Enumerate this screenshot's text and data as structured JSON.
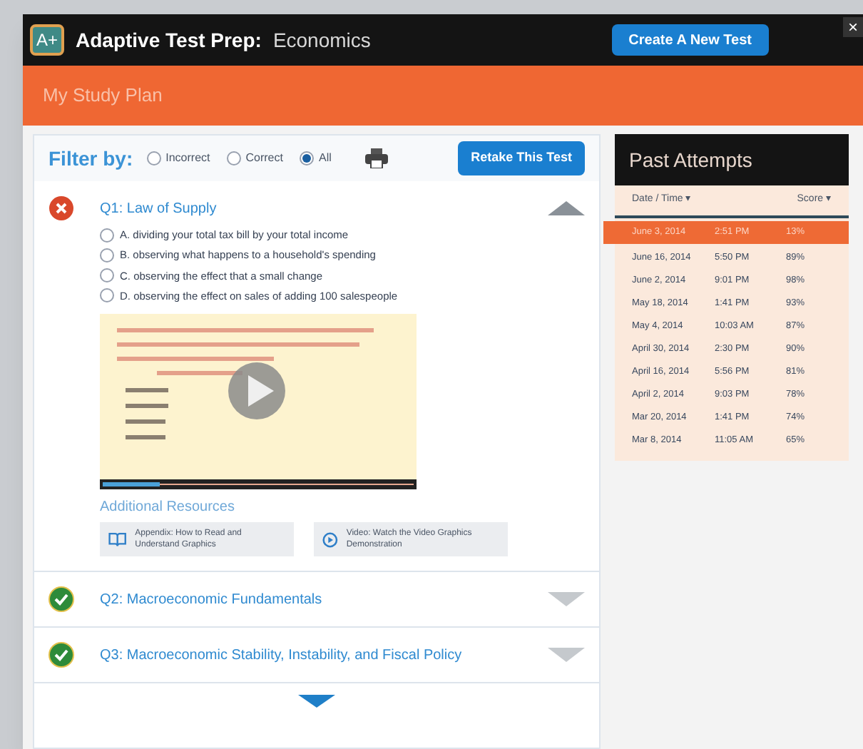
{
  "header": {
    "logo": "A+",
    "title_bold": "Adaptive Test Prep:",
    "title_subject": "Economics",
    "create_button": "Create A New Test",
    "close": "×"
  },
  "banner": {
    "title": "My Study Plan"
  },
  "filter": {
    "label": "Filter by:",
    "options": [
      {
        "label": "Incorrect",
        "selected": false
      },
      {
        "label": "Correct",
        "selected": false
      },
      {
        "label": "All",
        "selected": true
      }
    ],
    "retake_button": "Retake This Test"
  },
  "questions": [
    {
      "title": "Q1: Law of Supply",
      "correct": false,
      "expanded": true,
      "choices": [
        {
          "label": "A. dividing your total tax bill by your total income",
          "selected": false
        },
        {
          "label": "B. observing what happens to a household's spending",
          "selected": false
        },
        {
          "label": "C. observing the effect that a small change",
          "selected": false
        },
        {
          "label": "D. observing the effect on sales of adding 100 salespeople",
          "selected": false
        }
      ],
      "resources_title": "Additional Resources",
      "resources": [
        {
          "kind": "book",
          "label": "Appendix: How to Read and Understand Graphics"
        },
        {
          "kind": "video",
          "label": "Video: Watch the Video Graphics Demonstration"
        }
      ]
    },
    {
      "title": "Q2: Macroeconomic Fundamentals",
      "correct": true,
      "expanded": false
    },
    {
      "title": "Q3: Macroeconomic Stability, Instability, and Fiscal Policy",
      "correct": true,
      "expanded": false
    }
  ],
  "past_attempts": {
    "title": "Past Attempts",
    "columns": [
      "Date / Time ▾",
      "Score ▾"
    ],
    "rows": [
      {
        "date": "June 3, 2014",
        "time": "2:51 PM",
        "score": "13%",
        "selected": true
      },
      {
        "date": "June 16, 2014",
        "time": "5:50 PM",
        "score": "89%",
        "selected": false
      },
      {
        "date": "June 2, 2014",
        "time": "9:01 PM",
        "score": "98%",
        "selected": false
      },
      {
        "date": "May 18, 2014",
        "time": "1:41 PM",
        "score": "93%",
        "selected": false
      },
      {
        "date": "May 4, 2014",
        "time": "10:03 AM",
        "score": "87%",
        "selected": false
      },
      {
        "date": "April 30, 2014",
        "time": "2:30 PM",
        "score": "90%",
        "selected": false
      },
      {
        "date": "April 16, 2014",
        "time": "5:56 PM",
        "score": "81%",
        "selected": false
      },
      {
        "date": "April 2, 2014",
        "time": "9:03 PM",
        "score": "78%",
        "selected": false
      },
      {
        "date": "Mar 20, 2014",
        "time": "1:41 PM",
        "score": "74%",
        "selected": false
      },
      {
        "date": "Mar 8, 2014",
        "time": "11:05 AM",
        "score": "65%",
        "selected": false
      }
    ]
  }
}
